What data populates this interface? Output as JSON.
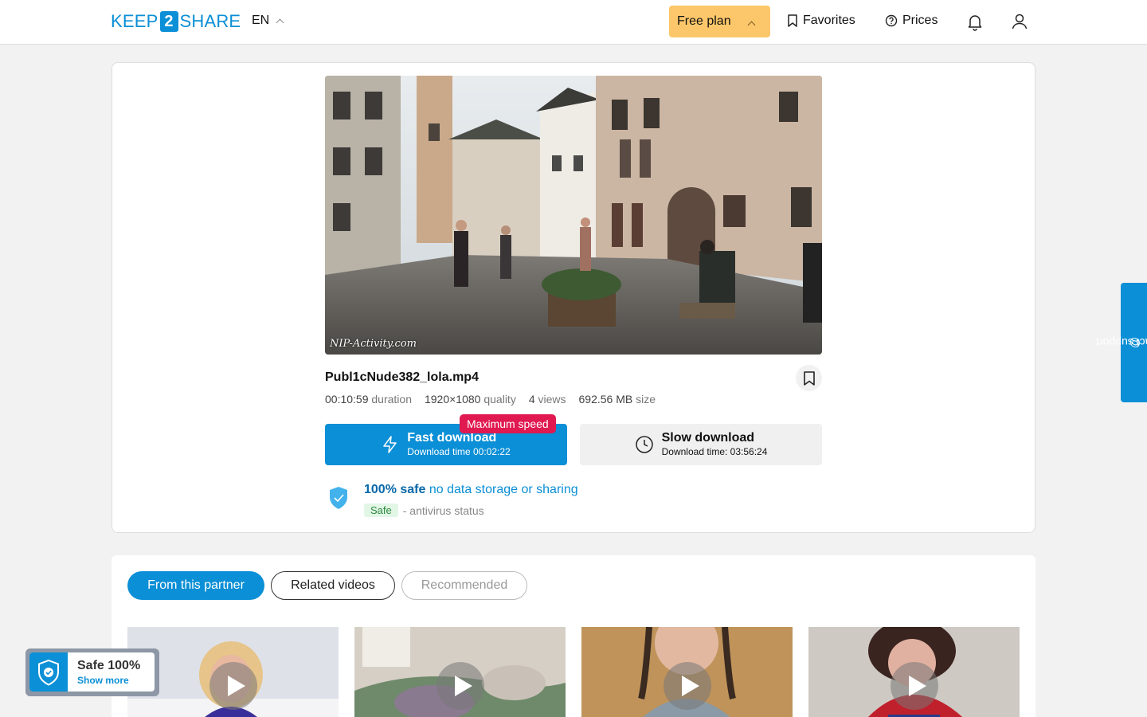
{
  "header": {
    "logo_left": "KEEP",
    "logo_num": "2",
    "logo_right": "SHARE",
    "language": "EN",
    "plan_label": "Free plan",
    "favorites_label": "Favorites",
    "prices_label": "Prices"
  },
  "preview": {
    "watermark": "NIP-Activity.com"
  },
  "file": {
    "name": "Publ1cNude382_lola.mp4",
    "duration_value": "00:10:59",
    "duration_label": "duration",
    "quality_value": "1920×1080",
    "quality_label": "quality",
    "views_value": "4",
    "views_label": "views",
    "size_value": "692.56 MB",
    "size_label": "size"
  },
  "download": {
    "fast_title": "Fast download",
    "fast_sub": "Download time 00:02:22",
    "max_badge": "Maximum speed",
    "slow_title": "Slow download",
    "slow_sub": "Download time: 03:56:24"
  },
  "safety": {
    "bold": "100% safe",
    "rest": "no data storage or sharing",
    "chip": "Safe",
    "status": "- antivirus status"
  },
  "support_label": "contact support",
  "tabs": [
    {
      "label": "From this partner"
    },
    {
      "label": "Related videos"
    },
    {
      "label": "Recommended"
    }
  ],
  "safe_widget": {
    "title": "Safe 100%",
    "link": "Show more"
  },
  "colors": {
    "accent": "#0b8fd6",
    "plan": "#fcc76a",
    "badge": "#e01950"
  }
}
